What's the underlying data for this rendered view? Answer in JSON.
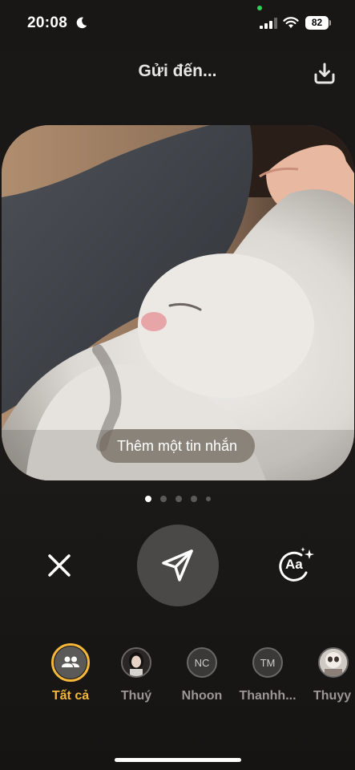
{
  "status_bar": {
    "time": "20:08",
    "battery": "82"
  },
  "header": {
    "title": "Gửi đến..."
  },
  "photo": {
    "caption_placeholder": "Thêm một tin nhắn"
  },
  "pager": {
    "count": 5,
    "active_index": 0
  },
  "controls": {
    "text_style_label": "Aa"
  },
  "recipients": [
    {
      "initials": "",
      "name": "Tất cả",
      "selected": true
    },
    {
      "initials": "",
      "name": "Thuý",
      "selected": false
    },
    {
      "initials": "NC",
      "name": "Nhoon",
      "selected": false
    },
    {
      "initials": "TM",
      "name": "Thanhh...",
      "selected": false
    },
    {
      "initials": "",
      "name": "Thuyy",
      "selected": false
    }
  ],
  "colors": {
    "accent": "#f4b73a",
    "background": "#1a1816",
    "send_button": "#4b4948"
  }
}
